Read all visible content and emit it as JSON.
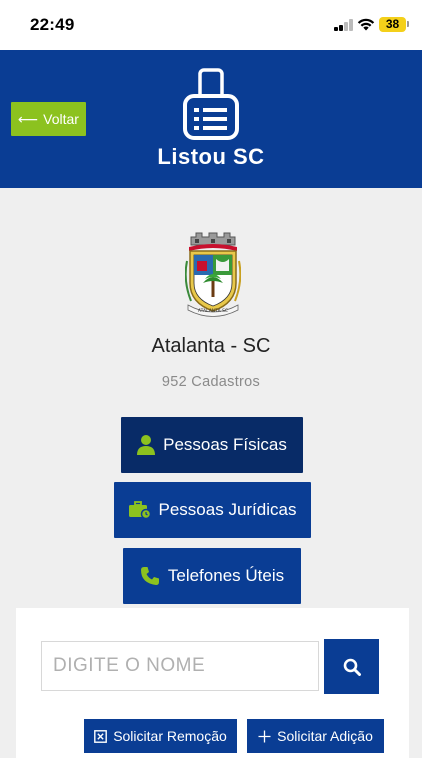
{
  "status_bar": {
    "time": "22:49",
    "battery": "38"
  },
  "header": {
    "back_label": "Voltar",
    "app_name": "Listou SC"
  },
  "city": {
    "name": "Atalanta - SC",
    "count_text": "952 Cadastros",
    "crest_text": "ATALANTA SC"
  },
  "categories": [
    {
      "label": "Pessoas Físicas",
      "icon": "user-icon"
    },
    {
      "label": "Pessoas Jurídicas",
      "icon": "briefcase-icon"
    },
    {
      "label": "Telefones Úteis",
      "icon": "phone-icon"
    }
  ],
  "search": {
    "placeholder": "DIGITE O NOME",
    "value": ""
  },
  "actions": {
    "remove_label": "Solicitar Remoção",
    "add_label": "Solicitar Adição"
  },
  "colors": {
    "primary": "#0a3d94",
    "dark": "#082b67",
    "accent": "#8cc21f",
    "background": "#efefef"
  }
}
